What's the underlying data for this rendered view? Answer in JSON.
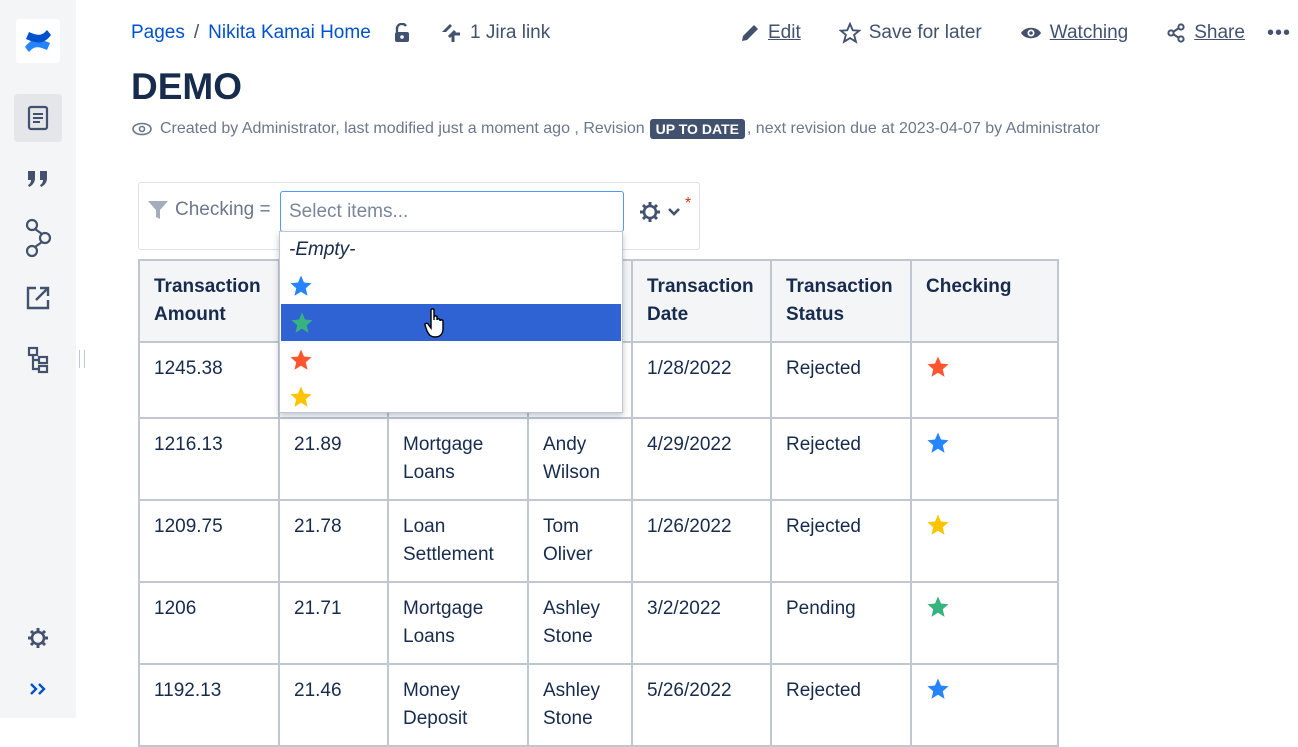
{
  "breadcrumb": {
    "root": "Pages",
    "page": "Nikita Kamai Home"
  },
  "jira_link": "1 Jira link",
  "actions": {
    "edit": "Edit",
    "save": "Save for later",
    "watch": "Watching",
    "share": "Share",
    "more": "•••"
  },
  "page_title": "DEMO",
  "meta": {
    "created": "Created by Administrator, last modified just a moment ago , Revision",
    "badge": "UP TO DATE",
    "next": ", next revision due at 2023-04-07 by Administrator"
  },
  "filter": {
    "label": "Checking =",
    "placeholder": "Select items...",
    "required_mark": "*"
  },
  "dropdown": {
    "empty_label": "-Empty-",
    "options": [
      {
        "star": "blue",
        "color": "#2684ff"
      },
      {
        "star": "green",
        "color": "#36b37e",
        "selected": true
      },
      {
        "star": "red",
        "color": "#ff5630"
      },
      {
        "star": "yellow",
        "color": "#ffc400"
      }
    ]
  },
  "table": {
    "headers": [
      "Transaction Amount",
      "",
      "",
      "",
      "Transaction Date",
      "Transaction Status",
      "Checking"
    ],
    "rows": [
      {
        "amount": "1245.38",
        "fee": "",
        "type": "",
        "person": "",
        "date": "1/28/2022",
        "status": "Rejected",
        "star_color": "#ff5630"
      },
      {
        "amount": "1216.13",
        "fee": "21.89",
        "type": "Mortgage Loans",
        "person": "Andy Wilson",
        "date": "4/29/2022",
        "status": "Rejected",
        "star_color": "#2684ff"
      },
      {
        "amount": "1209.75",
        "fee": "21.78",
        "type": "Loan Settlement",
        "person": "Tom Oliver",
        "date": "1/26/2022",
        "status": "Rejected",
        "star_color": "#ffc400"
      },
      {
        "amount": "1206",
        "fee": "21.71",
        "type": "Mortgage Loans",
        "person": "Ashley Stone",
        "date": "3/2/2022",
        "status": "Pending",
        "star_color": "#36b37e"
      },
      {
        "amount": "1192.13",
        "fee": "21.46",
        "type": "Money Deposit",
        "person": "Ashley Stone",
        "date": "5/26/2022",
        "status": "Rejected",
        "star_color": "#2684ff"
      }
    ]
  },
  "colors": {
    "link": "#0052cc",
    "selected": "#2f63d4",
    "badge": "#42526e"
  }
}
